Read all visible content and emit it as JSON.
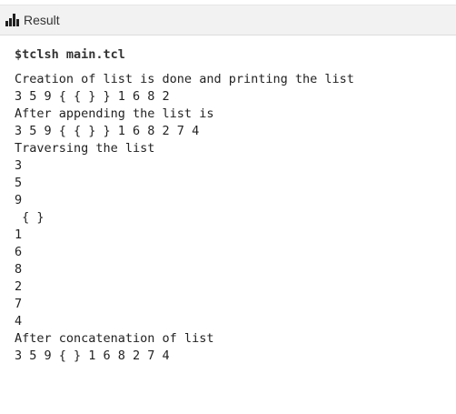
{
  "header": {
    "icon": "bar-chart-icon",
    "title": "Result"
  },
  "output": {
    "command": "$tclsh main.tcl",
    "lines": [
      "Creation of list is done and printing the list",
      "3 5 9 { { } } 1 6 8 2",
      "After appending the list is",
      "3 5 9 { { } } 1 6 8 2 7 4",
      "Traversing the list",
      "3",
      "5",
      "9",
      " { }",
      "1",
      "6",
      "8",
      "2",
      "7",
      "4",
      "After concatenation of list",
      "3 5 9 { } 1 6 8 2 7 4"
    ]
  }
}
